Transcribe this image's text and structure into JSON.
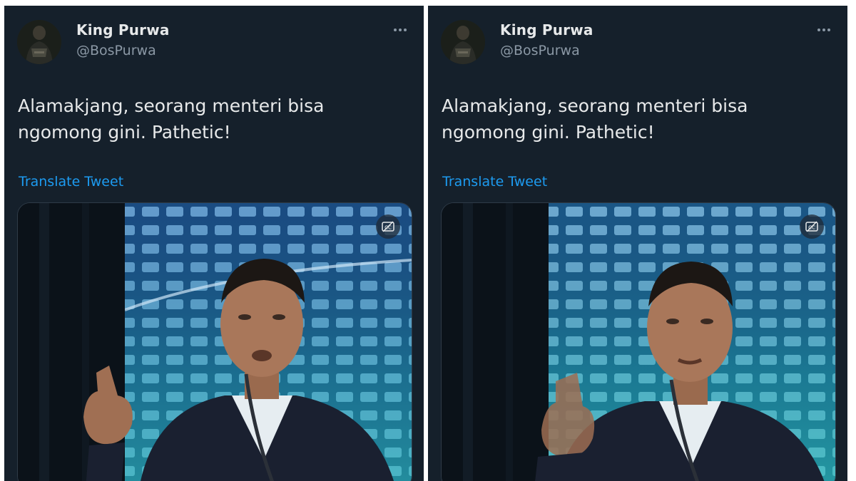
{
  "tweets": [
    {
      "user": {
        "name": "King Purwa",
        "handle": "@BosPurwa"
      },
      "text": "Alamakjang, seorang menteri bisa ngomong gini. Pathetic!",
      "translate_label": "Translate Tweet"
    },
    {
      "user": {
        "name": "King Purwa",
        "handle": "@BosPurwa"
      },
      "text": "Alamakjang, seorang menteri bisa ngomong gini. Pathetic!",
      "translate_label": "Translate Tweet"
    }
  ],
  "icons": {
    "more": "more-horizontal-icon",
    "captions": "captions-off-icon"
  },
  "colors": {
    "background": "#15202b",
    "text": "#e7e9ea",
    "secondary": "#8b98a5",
    "link": "#1d9bf0"
  }
}
